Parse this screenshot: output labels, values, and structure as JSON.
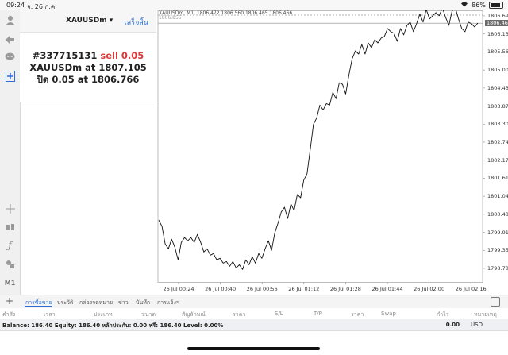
{
  "status_bar": {
    "time": "09:24",
    "date": "จ. 26 ก.ค.",
    "battery": "86%",
    "battery_level": 0.86
  },
  "order_panel": {
    "symbol": "XAUUSDm",
    "dropdown_arrow": "▾",
    "done_label": "เสร็จสิ้น",
    "ticket": "#337715131",
    "action": "sell 0.05",
    "open_line_symbol": "XAUUSDm at",
    "open_price": "1807.105",
    "close_line_prefix": "ปิด 0.05 at",
    "close_price": "1806.766"
  },
  "rail": {
    "timeframe": "M1"
  },
  "chart_header": {
    "ohlc": "XAUUSDm, M1, 1806.472 1806.560 1806.465 1806.466",
    "marker": "1806.855"
  },
  "chart_data": {
    "type": "line",
    "symbol": "XAUUSDm",
    "timeframe": "M1",
    "x_tick_labels": [
      "26 Jul 00:24",
      "26 Jul 00:40",
      "26 Jul 00:56",
      "26 Jul 01:12",
      "26 Jul 01:28",
      "26 Jul 01:44",
      "26 Jul 02:00",
      "26 Jul 02:16"
    ],
    "y_tick_labels": [
      "1806.695",
      "1806.130",
      "1805.565",
      "1805.000",
      "1804.435",
      "1803.870",
      "1803.305",
      "1802.740",
      "1802.175",
      "1801.610",
      "1801.045",
      "1800.480",
      "1799.915",
      "1799.350",
      "1798.785"
    ],
    "current_price_label": "1806.466",
    "ylim": [
      1798.5,
      1807.3
    ],
    "grid": false,
    "values": [
      1800.3,
      1800.1,
      1799.55,
      1799.4,
      1799.7,
      1799.45,
      1799.05,
      1799.6,
      1799.75,
      1799.65,
      1799.75,
      1799.6,
      1799.85,
      1799.6,
      1799.3,
      1799.4,
      1799.2,
      1799.25,
      1799.05,
      1799.1,
      1798.95,
      1799.0,
      1798.85,
      1799.0,
      1798.8,
      1798.9,
      1798.75,
      1799.05,
      1798.9,
      1799.15,
      1798.95,
      1799.25,
      1799.1,
      1799.4,
      1799.65,
      1799.35,
      1799.9,
      1800.2,
      1800.55,
      1800.7,
      1800.35,
      1800.8,
      1800.6,
      1801.1,
      1801.0,
      1801.55,
      1801.75,
      1802.5,
      1803.3,
      1803.5,
      1803.9,
      1803.75,
      1803.95,
      1803.9,
      1804.3,
      1804.1,
      1804.6,
      1804.55,
      1804.25,
      1804.85,
      1805.35,
      1805.6,
      1805.5,
      1805.8,
      1805.5,
      1805.85,
      1805.7,
      1805.95,
      1805.85,
      1806.0,
      1806.05,
      1806.3,
      1806.2,
      1806.15,
      1805.9,
      1806.3,
      1806.1,
      1806.4,
      1806.5,
      1806.2,
      1806.45,
      1806.75,
      1806.5,
      1806.9,
      1806.6,
      1806.7,
      1806.8,
      1806.7,
      1806.95,
      1806.65,
      1806.4,
      1806.85,
      1806.95,
      1806.6,
      1806.3,
      1806.2,
      1806.5,
      1806.45,
      1806.35,
      1806.47
    ]
  },
  "tabs": {
    "items": [
      "การซื้อขาย",
      "ประวัติ",
      "กล่องจดหมาย",
      "ข่าว",
      "บันทึก",
      "การแจ้งฯ"
    ],
    "active": "การซื้อขาย"
  },
  "columns": {
    "left": [
      "คำสั่ง",
      "เวลา",
      "ประเภท",
      "ขนาด",
      "สัญลักษณ์",
      "ราคา",
      "S/L",
      "T/P",
      "ราคา",
      "Swap"
    ],
    "right": [
      "กำไร",
      "หมายเหตุ"
    ]
  },
  "balance": {
    "text": "Balance: 186.40 Equity: 186.40 หลักประกัน: 0.00 ฟรี: 186.40 Level: 0.00%",
    "total": "0.00",
    "currency": "USD"
  }
}
